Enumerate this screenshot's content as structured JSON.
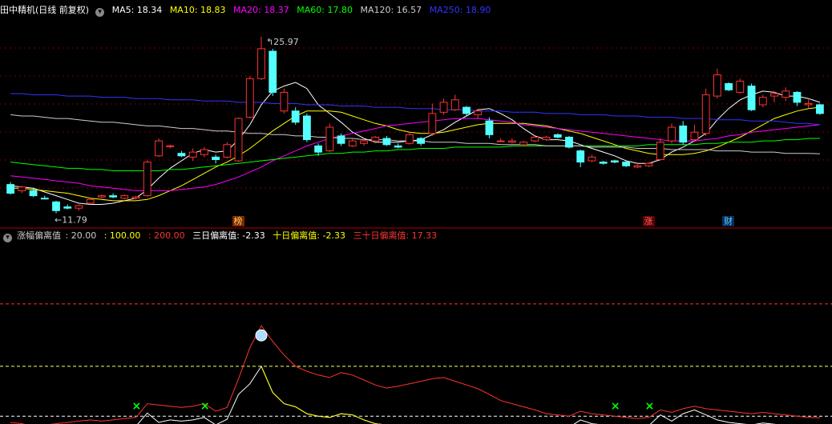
{
  "main_header": {
    "stock": "田中精机",
    "period": "(日线 前复权)",
    "ma": [
      {
        "label": "MA5: 18.34",
        "color": "#ffffff"
      },
      {
        "label": "MA10: 18.83",
        "color": "#ffff00"
      },
      {
        "label": "MA20: 18.37",
        "color": "#ff00ff"
      },
      {
        "label": "MA60: 17.80",
        "color": "#00ff00"
      },
      {
        "label": "MA120: 16.57",
        "color": "#cccccc"
      },
      {
        "label": "MA250: 18.90",
        "color": "#3333ff"
      }
    ]
  },
  "ind_header": {
    "title": "涨幅偏离值",
    "lv20": ": 20.00",
    "lv100": ": 100.00",
    "lv200": ": 200.00",
    "d3": "三日偏离值: -2.33",
    "d10": "十日偏离值: -2.33",
    "d30": "三十日偏离值: 17.33"
  },
  "colors": {
    "up": "#ff3232",
    "down": "#54ffff",
    "bg": "#000000",
    "grid": "#7a0000"
  },
  "annotations": {
    "high": "25.97",
    "low": "11.79"
  },
  "markers": [
    {
      "label": "榜",
      "index": 20,
      "color": "#ffcc66",
      "bg": "#7a2a00"
    },
    {
      "label": "涨",
      "index": 56,
      "color": "#ff6666",
      "bg": "#5a0000"
    },
    {
      "label": "财",
      "index": 63,
      "color": "#66ccff",
      "bg": "#00305a"
    }
  ],
  "chart_data": [
    {
      "type": "candlestick",
      "title": "田中精机 (日线 前复权)",
      "ylim": [
        10.8,
        27.5
      ],
      "ohlc": [
        [
          14.1,
          14.3,
          13.3,
          13.4
        ],
        [
          13.6,
          14.0,
          13.4,
          13.9
        ],
        [
          13.6,
          13.8,
          13.1,
          13.2
        ],
        [
          13.0,
          13.2,
          12.9,
          12.95
        ],
        [
          12.7,
          12.8,
          11.79,
          12.0
        ],
        [
          12.3,
          12.5,
          12.1,
          12.2
        ],
        [
          12.2,
          12.5,
          12.0,
          12.4
        ],
        [
          12.6,
          13.0,
          12.5,
          12.9
        ],
        [
          13.1,
          13.3,
          13.0,
          13.2
        ],
        [
          13.2,
          13.4,
          13.0,
          13.1
        ],
        [
          13.0,
          13.3,
          12.9,
          13.2
        ],
        [
          13.0,
          13.2,
          12.9,
          13.1
        ],
        [
          13.2,
          16.1,
          13.1,
          15.9
        ],
        [
          16.4,
          17.8,
          16.3,
          17.6
        ],
        [
          17.2,
          17.3,
          17.0,
          17.2
        ],
        [
          16.6,
          16.8,
          16.3,
          16.4
        ],
        [
          16.3,
          17.0,
          16.0,
          16.7
        ],
        [
          16.5,
          17.1,
          16.3,
          16.9
        ],
        [
          16.3,
          16.5,
          15.8,
          16.1
        ],
        [
          16.3,
          17.5,
          16.2,
          17.3
        ],
        [
          16.0,
          19.5,
          15.9,
          19.4
        ],
        [
          19.5,
          22.8,
          19.4,
          22.6
        ],
        [
          22.6,
          25.97,
          22.5,
          25.0
        ],
        [
          24.8,
          25.0,
          21.2,
          21.5
        ],
        [
          20.0,
          21.8,
          19.8,
          21.5
        ],
        [
          20.0,
          20.3,
          18.9,
          19.1
        ],
        [
          19.6,
          19.8,
          17.5,
          17.7
        ],
        [
          17.2,
          17.4,
          16.4,
          16.7
        ],
        [
          16.8,
          19.0,
          16.7,
          18.7
        ],
        [
          18.0,
          18.2,
          17.2,
          17.4
        ],
        [
          17.2,
          17.8,
          17.1,
          17.6
        ],
        [
          17.4,
          17.8,
          17.2,
          17.6
        ],
        [
          17.6,
          18.0,
          17.4,
          17.9
        ],
        [
          17.8,
          18.0,
          17.2,
          17.3
        ],
        [
          17.2,
          17.4,
          17.0,
          17.1
        ],
        [
          17.4,
          18.3,
          17.3,
          18.1
        ],
        [
          17.8,
          17.9,
          17.2,
          17.4
        ],
        [
          18.2,
          20.6,
          18.0,
          19.8
        ],
        [
          19.9,
          21.0,
          19.7,
          20.7
        ],
        [
          20.1,
          21.3,
          20.0,
          20.9
        ],
        [
          20.3,
          20.4,
          19.6,
          19.8
        ],
        [
          19.7,
          20.2,
          19.4,
          20.0
        ],
        [
          19.2,
          19.5,
          17.8,
          18.1
        ],
        [
          17.6,
          17.8,
          17.5,
          17.6
        ],
        [
          17.5,
          17.8,
          17.4,
          17.6
        ],
        [
          17.3,
          17.6,
          17.2,
          17.5
        ],
        [
          17.6,
          18.0,
          17.5,
          17.9
        ],
        [
          17.7,
          18.0,
          17.6,
          17.9
        ],
        [
          18.1,
          18.2,
          17.8,
          17.9
        ],
        [
          17.9,
          18.0,
          17.0,
          17.1
        ],
        [
          16.8,
          16.9,
          15.5,
          15.9
        ],
        [
          16.0,
          16.5,
          15.9,
          16.3
        ],
        [
          15.9,
          16.0,
          15.7,
          15.8
        ],
        [
          16.0,
          16.1,
          15.8,
          15.9
        ],
        [
          15.9,
          16.0,
          15.5,
          15.6
        ],
        [
          15.5,
          15.8,
          15.4,
          15.6
        ],
        [
          15.6,
          15.9,
          15.5,
          15.8
        ],
        [
          16.1,
          17.8,
          16.0,
          17.5
        ],
        [
          17.6,
          19.0,
          17.4,
          18.7
        ],
        [
          18.8,
          19.2,
          17.3,
          17.5
        ],
        [
          17.7,
          18.9,
          17.5,
          18.3
        ],
        [
          18.2,
          21.8,
          18.0,
          21.3
        ],
        [
          21.2,
          23.4,
          21.0,
          22.9
        ],
        [
          22.2,
          22.3,
          21.6,
          21.7
        ],
        [
          21.5,
          22.6,
          21.4,
          22.4
        ],
        [
          22.0,
          22.2,
          20.0,
          20.1
        ],
        [
          20.5,
          21.3,
          20.3,
          21.1
        ],
        [
          21.2,
          21.6,
          20.7,
          21.4
        ],
        [
          21.1,
          21.9,
          20.8,
          21.6
        ],
        [
          21.5,
          21.6,
          20.4,
          20.7
        ],
        [
          20.5,
          21.0,
          20.2,
          20.6
        ],
        [
          20.5,
          20.6,
          19.7,
          19.8
        ]
      ],
      "series": [
        {
          "name": "MA5",
          "values": [
            14.0,
            13.9,
            13.8,
            13.5,
            13.2,
            12.9,
            12.6,
            12.5,
            12.5,
            12.6,
            12.8,
            13.0,
            13.7,
            14.6,
            15.4,
            16.0,
            16.6,
            16.9,
            16.7,
            16.8,
            17.7,
            18.9,
            20.5,
            21.6,
            22.0,
            22.3,
            21.8,
            20.5,
            19.8,
            19.1,
            18.3,
            17.8,
            17.5,
            17.5,
            17.5,
            17.6,
            17.7,
            18.1,
            18.5,
            19.1,
            19.6,
            20.1,
            20.2,
            19.8,
            19.3,
            18.6,
            18.0,
            17.7,
            17.7,
            17.6,
            17.3,
            17.0,
            16.7,
            16.4,
            16.0,
            15.8,
            15.8,
            16.1,
            16.7,
            17.1,
            17.6,
            18.2,
            19.3,
            20.2,
            20.9,
            21.3,
            21.6,
            21.5,
            21.2,
            21.2,
            21.0,
            20.7
          ]
        },
        {
          "name": "MA10",
          "values": [
            13.8,
            13.8,
            13.7,
            13.6,
            13.5,
            13.4,
            13.2,
            13.0,
            12.9,
            12.8,
            12.8,
            12.8,
            12.9,
            13.2,
            13.6,
            14.0,
            14.5,
            15.0,
            15.5,
            15.9,
            16.4,
            17.0,
            17.7,
            18.4,
            19.0,
            19.6,
            20.0,
            20.0,
            20.0,
            19.9,
            19.6,
            19.3,
            19.0,
            18.8,
            18.5,
            18.3,
            18.2,
            18.2,
            18.3,
            18.5,
            18.7,
            18.9,
            19.0,
            19.0,
            19.0,
            19.0,
            18.9,
            18.8,
            18.6,
            18.4,
            18.2,
            17.9,
            17.6,
            17.3,
            17.0,
            16.8,
            16.6,
            16.5,
            16.5,
            16.5,
            16.6,
            16.8,
            17.1,
            17.5,
            17.9,
            18.4,
            18.9,
            19.4,
            19.7,
            20.0,
            20.2,
            20.3
          ]
        },
        {
          "name": "MA20",
          "values": [
            14.8,
            14.7,
            14.6,
            14.5,
            14.4,
            14.3,
            14.2,
            14.0,
            13.9,
            13.8,
            13.7,
            13.6,
            13.6,
            13.6,
            13.6,
            13.7,
            13.8,
            13.9,
            14.1,
            14.4,
            14.7,
            15.1,
            15.5,
            16.0,
            16.4,
            16.8,
            17.2,
            17.5,
            17.8,
            18.0,
            18.2,
            18.4,
            18.6,
            18.8,
            18.9,
            19.0,
            19.1,
            19.2,
            19.3,
            19.4,
            19.4,
            19.4,
            19.3,
            19.2,
            19.1,
            18.9,
            18.8,
            18.7,
            18.6,
            18.5,
            18.4,
            18.3,
            18.2,
            18.1,
            18.0,
            17.9,
            17.8,
            17.7,
            17.6,
            17.6,
            17.6,
            17.7,
            17.8,
            18.0,
            18.1,
            18.3,
            18.4,
            18.5,
            18.6,
            18.7,
            18.8,
            18.9
          ]
        },
        {
          "name": "MA60",
          "values": [
            15.9,
            15.8,
            15.7,
            15.6,
            15.5,
            15.4,
            15.4,
            15.3,
            15.3,
            15.2,
            15.2,
            15.2,
            15.2,
            15.2,
            15.3,
            15.3,
            15.4,
            15.5,
            15.6,
            15.7,
            15.8,
            15.9,
            16.0,
            16.1,
            16.2,
            16.3,
            16.4,
            16.5,
            16.6,
            16.6,
            16.7,
            16.7,
            16.8,
            16.8,
            16.9,
            16.9,
            17.0,
            17.0,
            17.0,
            17.1,
            17.1,
            17.1,
            17.1,
            17.1,
            17.2,
            17.2,
            17.2,
            17.2,
            17.2,
            17.2,
            17.2,
            17.2,
            17.2,
            17.2,
            17.2,
            17.2,
            17.3,
            17.3,
            17.3,
            17.3,
            17.3,
            17.4,
            17.4,
            17.5,
            17.5,
            17.5,
            17.6,
            17.6,
            17.7,
            17.7,
            17.8,
            17.8
          ]
        },
        {
          "name": "MA120",
          "values": [
            19.7,
            19.6,
            19.6,
            19.5,
            19.4,
            19.4,
            19.3,
            19.2,
            19.1,
            19.1,
            19.0,
            18.9,
            18.8,
            18.8,
            18.7,
            18.6,
            18.6,
            18.5,
            18.4,
            18.4,
            18.3,
            18.2,
            18.2,
            18.1,
            18.1,
            18.0,
            18.0,
            17.9,
            17.9,
            17.8,
            17.8,
            17.7,
            17.7,
            17.7,
            17.6,
            17.6,
            17.6,
            17.5,
            17.5,
            17.5,
            17.4,
            17.4,
            17.4,
            17.3,
            17.3,
            17.3,
            17.3,
            17.2,
            17.2,
            17.2,
            17.2,
            17.1,
            17.1,
            17.1,
            17.1,
            17.0,
            17.0,
            17.0,
            16.9,
            16.9,
            16.9,
            16.9,
            16.8,
            16.8,
            16.8,
            16.7,
            16.7,
            16.7,
            16.6,
            16.6,
            16.6,
            16.57
          ]
        },
        {
          "name": "MA250",
          "values": [
            21.4,
            21.4,
            21.3,
            21.3,
            21.3,
            21.2,
            21.2,
            21.2,
            21.1,
            21.1,
            21.1,
            21.0,
            21.0,
            21.0,
            20.9,
            20.9,
            20.9,
            20.8,
            20.8,
            20.8,
            20.7,
            20.7,
            20.7,
            20.6,
            20.6,
            20.6,
            20.5,
            20.5,
            20.5,
            20.4,
            20.4,
            20.4,
            20.3,
            20.3,
            20.3,
            20.2,
            20.2,
            20.2,
            20.1,
            20.1,
            20.1,
            20.0,
            20.0,
            20.0,
            19.9,
            19.9,
            19.9,
            19.8,
            19.8,
            19.8,
            19.7,
            19.7,
            19.7,
            19.6,
            19.6,
            19.6,
            19.5,
            19.5,
            19.5,
            19.4,
            19.4,
            19.4,
            19.3,
            19.3,
            19.3,
            19.2,
            19.2,
            19.2,
            19.1,
            19.0,
            19.0,
            18.9
          ]
        }
      ]
    },
    {
      "type": "line",
      "title": "涨幅偏离值",
      "ylim": [
        10,
        300
      ],
      "reference_lines": [
        20,
        100,
        200
      ],
      "series": [
        {
          "name": "三日偏离值",
          "values": [
            2,
            4,
            1,
            3,
            6,
            2,
            4,
            5,
            3,
            4,
            6,
            4,
            25,
            10,
            14,
            12,
            14,
            18,
            6,
            15,
            55,
            72,
            100,
            58,
            40,
            35,
            24,
            20,
            18,
            24,
            22,
            14,
            8,
            6,
            5,
            4,
            3,
            2,
            3,
            4,
            5,
            6,
            5,
            4,
            3,
            4,
            5,
            4,
            3,
            2,
            14,
            8,
            6,
            5,
            4,
            3,
            5,
            22,
            12,
            24,
            30,
            22,
            14,
            10,
            8,
            6,
            9,
            7,
            5,
            2,
            1,
            0
          ]
        },
        {
          "name": "十日偏离值",
          "values": [
            2,
            4,
            1,
            3,
            6,
            2,
            4,
            5,
            3,
            4,
            6,
            4,
            25,
            10,
            14,
            12,
            14,
            18,
            6,
            15,
            55,
            72,
            100,
            58,
            40,
            35,
            24,
            20,
            18,
            24,
            22,
            14,
            8,
            6,
            5,
            4,
            3,
            2,
            3,
            4,
            5,
            6,
            5,
            4,
            3,
            4,
            5,
            4,
            3,
            2,
            14,
            8,
            6,
            5,
            4,
            3,
            5,
            22,
            12,
            24,
            30,
            22,
            14,
            10,
            8,
            6,
            9,
            7,
            5,
            2,
            1,
            0
          ]
        },
        {
          "name": "三十日偏离值",
          "values": [
            10,
            8,
            4,
            6,
            8,
            10,
            12,
            14,
            12,
            14,
            16,
            18,
            40,
            38,
            36,
            34,
            36,
            40,
            28,
            34,
            80,
            130,
            165,
            140,
            118,
            100,
            92,
            86,
            82,
            90,
            86,
            78,
            70,
            65,
            68,
            72,
            76,
            80,
            82,
            76,
            70,
            64,
            55,
            45,
            40,
            35,
            30,
            24,
            22,
            20,
            28,
            24,
            22,
            20,
            18,
            16,
            18,
            30,
            26,
            32,
            36,
            32,
            30,
            28,
            26,
            24,
            26,
            24,
            22,
            20,
            18,
            17.33
          ]
        }
      ],
      "markers": [
        {
          "type": "x",
          "index": 11,
          "color": "#00ff00"
        },
        {
          "type": "x",
          "index": 17,
          "color": "#00ff00"
        },
        {
          "type": "x",
          "index": 53,
          "color": "#00ff00"
        },
        {
          "type": "x",
          "index": 56,
          "color": "#00ff00"
        }
      ]
    }
  ]
}
